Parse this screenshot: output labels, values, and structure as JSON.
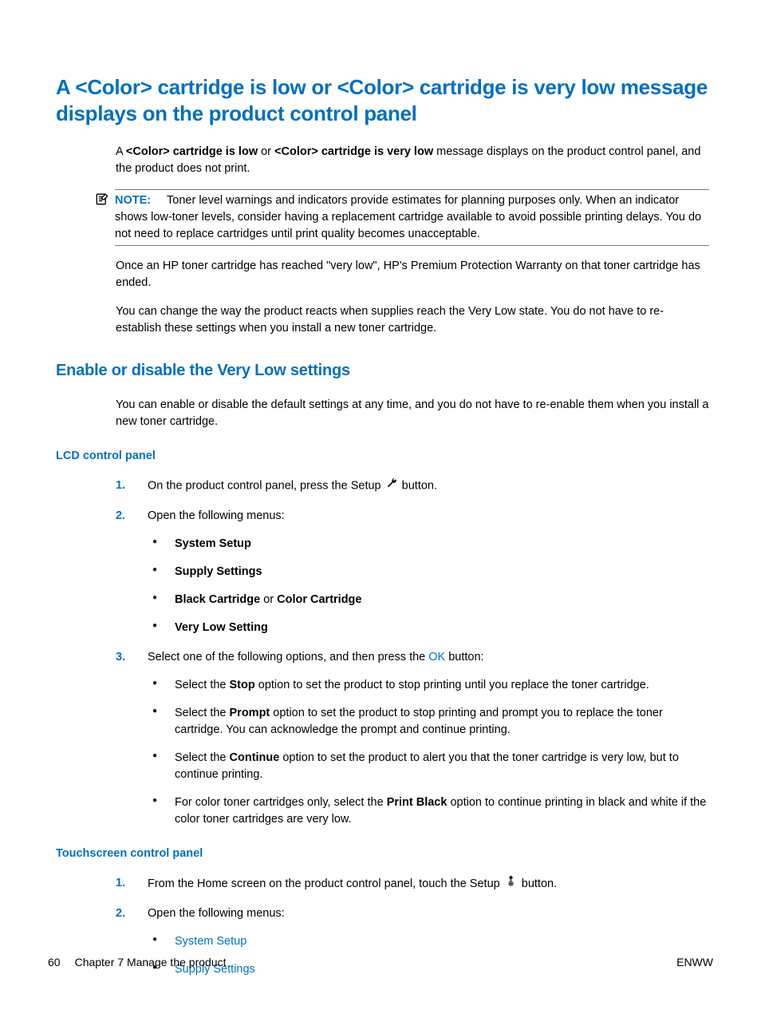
{
  "h1": "A <Color> cartridge is low or <Color> cartridge is very low message displays on the product control panel",
  "intro": {
    "prefix": "A ",
    "bold1": "<Color> cartridge is low",
    "mid1": " or ",
    "bold2": "<Color> cartridge is very low",
    "suffix": " message displays on the product control panel, and the product does not print."
  },
  "note": {
    "label": "NOTE:",
    "text": "Toner level warnings and indicators provide estimates for planning purposes only. When an indicator shows low-toner levels, consider having a replacement cartridge available to avoid possible printing delays. You do not need to replace cartridges until print quality becomes unacceptable."
  },
  "para2": "Once an HP toner cartridge has reached \"very low\", HP's Premium Protection Warranty on that toner cartridge has ended.",
  "para3": "You can change the way the product reacts when supplies reach the Very Low state. You do not have to re-establish these settings when you install a new toner cartridge.",
  "h2": "Enable or disable the Very Low settings",
  "para4": "You can enable or disable the default settings at any time, and you do not have to re-enable them when you install a new toner cartridge.",
  "h3a": "LCD control panel",
  "lcd": {
    "s1a": "On the product control panel, press the Setup ",
    "s1b": " button.",
    "s2": "Open the following menus:",
    "m1": "System Setup",
    "m2": "Supply Settings",
    "m3a": "Black Cartridge",
    "m3mid": " or ",
    "m3b": "Color Cartridge",
    "m4": "Very Low Setting",
    "s3a": "Select one of the following options, and then press the ",
    "s3ok": "OK",
    "s3b": " button:",
    "o1a": "Select the ",
    "o1b": "Stop",
    "o1c": " option to set the product to stop printing until you replace the toner cartridge.",
    "o2a": "Select the ",
    "o2b": "Prompt",
    "o2c": " option to set the product to stop printing and prompt you to replace the toner cartridge. You can acknowledge the prompt and continue printing.",
    "o3a": "Select the ",
    "o3b": "Continue",
    "o3c": " option to set the product to alert you that the toner cartridge is very low, but to continue printing.",
    "o4a": "For color toner cartridges only, select the ",
    "o4b": "Print Black",
    "o4c": " option to continue printing in black and white if the color toner cartridges are very low."
  },
  "h3b": "Touchscreen control panel",
  "ts": {
    "s1a": "From the Home screen on the product control panel, touch the Setup ",
    "s1b": " button.",
    "s2": "Open the following menus:",
    "m1": "System Setup",
    "m2": "Supply Settings"
  },
  "footer": {
    "page": "60",
    "chapter": "Chapter 7   Manage the product",
    "lang": "ENWW"
  }
}
